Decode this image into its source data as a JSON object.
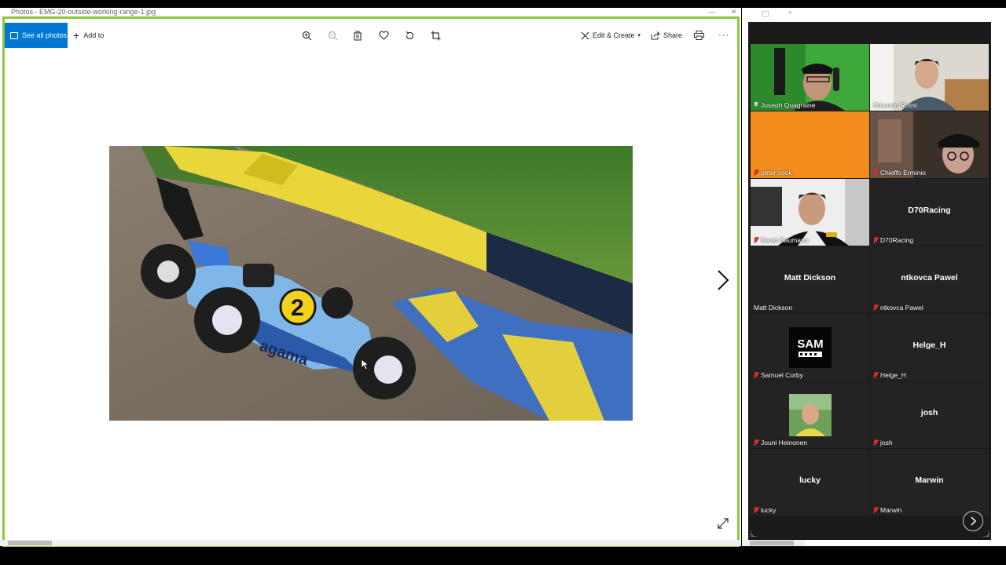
{
  "photos": {
    "title": "Photos - EMG-20-outside-working-range-1.jpg",
    "toolbar": {
      "see_all_label": "See all photos",
      "add_to_label": "Add to",
      "edit_create_label": "Edit & Create",
      "share_label": "Share",
      "more_label": "···"
    },
    "icons": [
      "zoom-in-icon",
      "zoom-out-icon",
      "delete-icon",
      "favorite-icon",
      "rotate-icon",
      "crop-icon",
      "print-icon",
      "expand-icon",
      "next-arrow-icon"
    ],
    "accent": "#0078d4",
    "frame_color": "#8dc63f",
    "photo_caption": {
      "car_number": "2",
      "car_brand": "agama"
    }
  },
  "zoom": {
    "participants": [
      {
        "name": "Joseph Quagraine",
        "video": true,
        "active": true,
        "mic": "pinned"
      },
      {
        "name": "Eduardo Rossi",
        "video": true,
        "mic": "none"
      },
      {
        "name": "peter cook",
        "video": false,
        "bg": "#f28c1c",
        "mic": "off"
      },
      {
        "name": "Chieffo Erminio",
        "video": true,
        "mic": "off"
      },
      {
        "name": "David Baumann",
        "video": true,
        "mic": "off"
      },
      {
        "name": "D70Racing",
        "video": false,
        "mic": "off"
      },
      {
        "name": "Matt Dickson",
        "video": false,
        "mic": "none"
      },
      {
        "name": "ntkovca Pawel",
        "video": false,
        "mic": "off"
      },
      {
        "name": "Samuel Corby",
        "video": false,
        "logo": "SAM",
        "mic": "off"
      },
      {
        "name": "Helge_H",
        "video": false,
        "mic": "off"
      },
      {
        "name": "Jouni Heinonen",
        "video": false,
        "avatar": true,
        "mic": "off"
      },
      {
        "name": "josh",
        "video": false,
        "mic": "off"
      },
      {
        "name": "lucky",
        "video": false,
        "mic": "off"
      },
      {
        "name": "Marwin",
        "video": false,
        "mic": "off"
      }
    ],
    "active_color": "#c8e000",
    "muted_color": "#d92c2c"
  }
}
